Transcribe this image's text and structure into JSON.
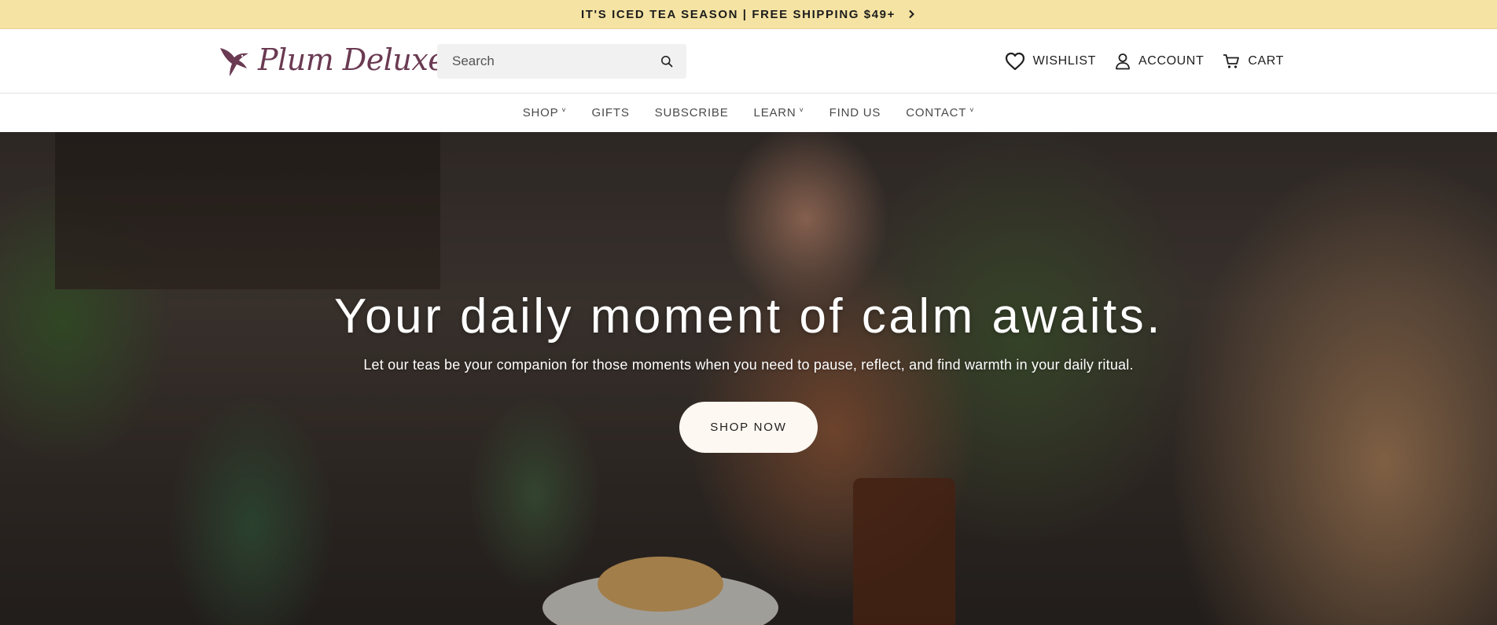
{
  "announcement": {
    "text": "IT'S ICED TEA SEASON | FREE SHIPPING $49+",
    "icon": "chevron-right-icon"
  },
  "header": {
    "logo_text": "Plum Deluxe",
    "logo_icon": "hummingbird-icon",
    "search": {
      "placeholder": "Search",
      "value": "",
      "icon": "search-icon"
    },
    "utilities": [
      {
        "label": "WISHLIST",
        "icon": "heart-icon"
      },
      {
        "label": "ACCOUNT",
        "icon": "user-icon"
      },
      {
        "label": "CART",
        "icon": "cart-icon"
      }
    ]
  },
  "nav": {
    "items": [
      {
        "label": "SHOP",
        "has_dropdown": true
      },
      {
        "label": "GIFTS",
        "has_dropdown": false
      },
      {
        "label": "SUBSCRIBE",
        "has_dropdown": false
      },
      {
        "label": "LEARN",
        "has_dropdown": true
      },
      {
        "label": "FIND US",
        "has_dropdown": false
      },
      {
        "label": "CONTACT",
        "has_dropdown": true
      }
    ],
    "caret": "˅"
  },
  "hero": {
    "title": "Your daily moment of calm awaits.",
    "subtitle": "Let our teas be your companion for those moments when you need to pause, reflect, and find warmth in your daily ritual.",
    "cta_label": "SHOP NOW"
  },
  "colors": {
    "announcement_bg": "#f5e3a3",
    "brand_plum": "#6a3a52",
    "cta_bg": "#fdf8f1"
  }
}
